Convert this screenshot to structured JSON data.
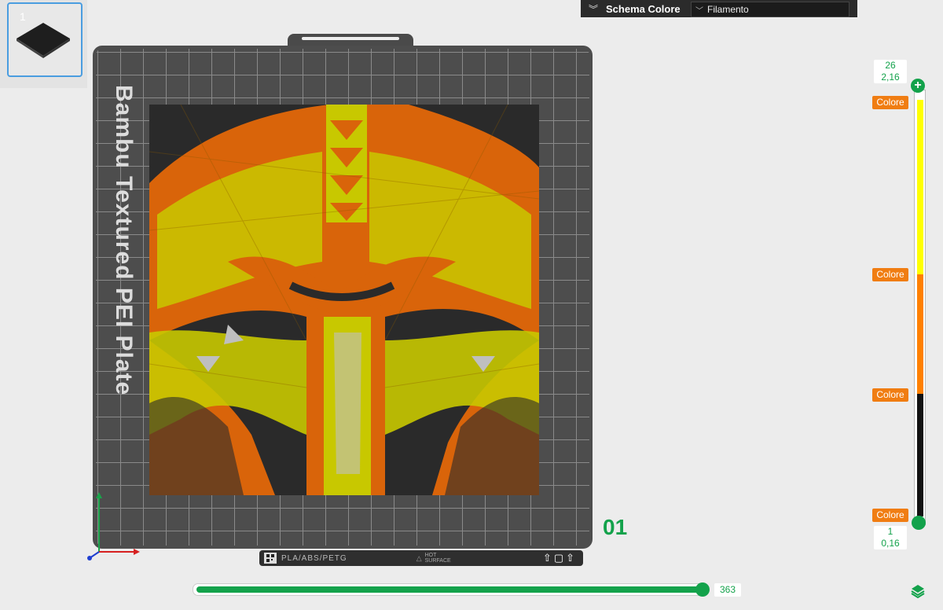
{
  "plate_thumbnail": {
    "number": "1"
  },
  "color_scheme": {
    "title": "Schema Colore",
    "selected": "Filamento"
  },
  "plate": {
    "label": "Bambu Textured PEI Plate",
    "footer_materials": "PLA/ABS/PETG",
    "footer_hot_line1": "HOT",
    "footer_hot_line2": "SURFACE",
    "plate_number": "01"
  },
  "layer_slider": {
    "top_layer": "26",
    "top_height": "2,16",
    "bottom_layer": "1",
    "bottom_height": "0,16",
    "color_tags": [
      "Colore",
      "Colore",
      "Colore",
      "Colore"
    ],
    "segments": [
      {
        "color": "#ffff00"
      },
      {
        "color": "#ff8000"
      },
      {
        "color": "#111111"
      }
    ]
  },
  "move_slider": {
    "value": "363"
  },
  "colors": {
    "accent": "#13a24b",
    "tag": "#f07d12",
    "model_yellow": "#c8c800",
    "model_orange": "#d9640a",
    "model_black": "#2a2a2a"
  },
  "icons": {
    "collapse": "double-chevron-down-icon",
    "dropdown": "chevron-down-icon",
    "layers": "layers-icon",
    "add": "plus-icon"
  }
}
